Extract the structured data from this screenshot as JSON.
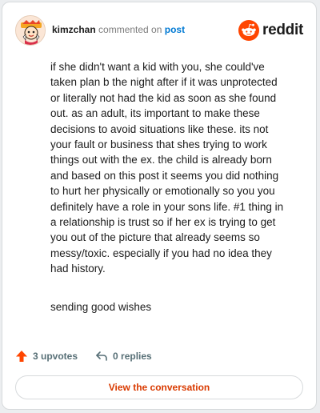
{
  "header": {
    "username": "kimzchan",
    "action_text": "commented on",
    "post_link": "post",
    "brand": "reddit"
  },
  "comment": {
    "paragraph": "if she didn't want a kid with you, she could've\ntaken plan b the night after if it was unprotected\nor literally not had the kid as soon as she found\nout. as an adult, its important to make these\ndecisions to avoid situations like these. its not\nyour fault or business that shes trying to work\nthings out with the ex. the child is already born\nand based on this post it seems you did nothing\nto hurt her physically or emotionally so you you\ndefinitely have a role in your sons life. #1 thing in\na relationship is trust so if her ex is trying to get\nyou out of the picture that already seems so\nmessy/toxic. especially if you had no idea they\nhad history.",
    "closing": "sending good wishes"
  },
  "actions": {
    "upvotes": "3 upvotes",
    "replies": "0 replies"
  },
  "footer": {
    "view_button": "View the conversation"
  },
  "colors": {
    "brand_orange": "#ff4500",
    "link_blue": "#0079d3",
    "button_text": "#d93a00"
  },
  "icons": [
    "avatar",
    "reddit-logo-icon",
    "upvote-arrow-icon",
    "reply-arrow-icon"
  ]
}
